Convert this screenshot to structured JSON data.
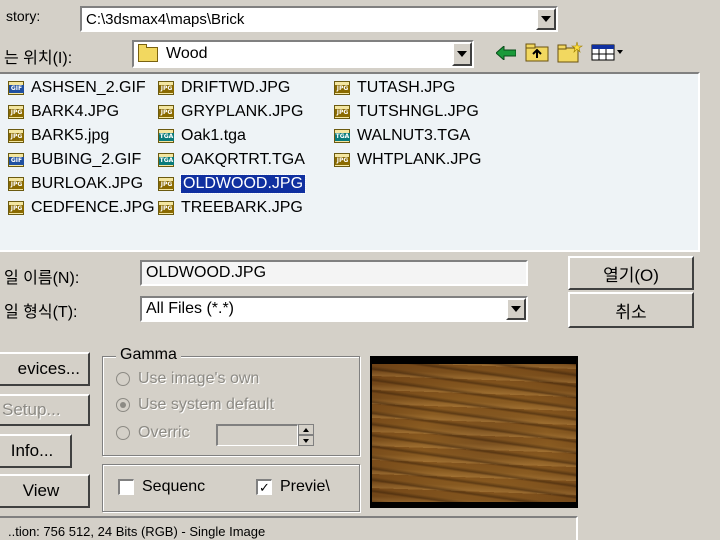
{
  "history": {
    "label": "story:",
    "value": "C:\\3dsmax4\\maps\\Brick"
  },
  "look_in": {
    "label": "는 위치(I):",
    "value": "Wood",
    "folder_icon": "folder-icon"
  },
  "toolbar": {
    "icons": [
      "back-arrow-icon",
      "up-folder-icon",
      "new-folder-icon",
      "view-menu-icon"
    ]
  },
  "files": [
    {
      "name": "ASHSEN_2.GIF",
      "type": "GIF"
    },
    {
      "name": "BARK4.JPG",
      "type": "JPG"
    },
    {
      "name": "BARK5.jpg",
      "type": "JPG"
    },
    {
      "name": "BUBING_2.GIF",
      "type": "GIF"
    },
    {
      "name": "BURLOAK.JPG",
      "type": "JPG"
    },
    {
      "name": "CEDFENCE.JPG",
      "type": "JPG"
    },
    {
      "name": "DRIFTWD.JPG",
      "type": "JPG"
    },
    {
      "name": "GRYPLANK.JPG",
      "type": "JPG"
    },
    {
      "name": "Oak1.tga",
      "type": "TGA"
    },
    {
      "name": "OAKQRTRT.TGA",
      "type": "TGA"
    },
    {
      "name": "OLDWOOD.JPG",
      "type": "JPG",
      "selected": true
    },
    {
      "name": "TREEBARK.JPG",
      "type": "JPG"
    },
    {
      "name": "TUTASH.JPG",
      "type": "JPG"
    },
    {
      "name": "TUTSHNGL.JPG",
      "type": "JPG"
    },
    {
      "name": "WALNUT3.TGA",
      "type": "TGA"
    },
    {
      "name": "WHTPLANK.JPG",
      "type": "JPG"
    }
  ],
  "filename": {
    "label": "일 이름(N):",
    "value": "OLDWOOD.JPG"
  },
  "filetype": {
    "label": "일 형식(T):",
    "value": "All Files (*.*)"
  },
  "buttons": {
    "open": "열기(O)",
    "cancel": "취소",
    "devices": "evices...",
    "setup": "Setup...",
    "info": "Info...",
    "view": "View"
  },
  "gamma": {
    "title": "Gamma",
    "option_own": "Use image's own",
    "option_system": "Use system default",
    "option_override": "Overric",
    "selected": "Use system default"
  },
  "checks": {
    "sequence_label": "Sequenc",
    "sequence_checked": false,
    "preview_label": "Previe\\",
    "preview_checked": true
  },
  "status": {
    "text": "..tion: 756 512, 24 Bits (RGB) - Single Image"
  },
  "colors": {
    "dialog_bg": "#d4d0c8",
    "list_bg": "#eef3f6",
    "selection": "#1030a0"
  }
}
